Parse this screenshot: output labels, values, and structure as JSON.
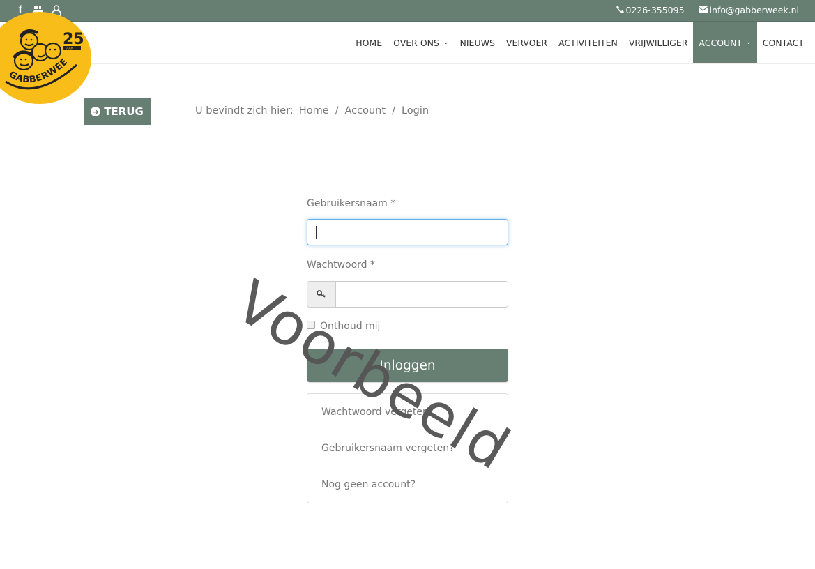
{
  "topbar": {
    "social": [
      {
        "name": "facebook-icon",
        "glyph": "f"
      },
      {
        "name": "youtube-icon",
        "glyph": "▶"
      },
      {
        "name": "user-icon",
        "glyph": "👤"
      }
    ],
    "phone": "0226-355095",
    "email": "info@gabberweek.nl",
    "phone_icon": "✆",
    "email_icon": "✉"
  },
  "logo": {
    "text": "GABBERWEEK",
    "anniversary": "25",
    "anniversary_suffix": "JAAR"
  },
  "nav": {
    "items": [
      {
        "label": "HOME",
        "dropdown": false,
        "active": false
      },
      {
        "label": "OVER ONS",
        "dropdown": true,
        "active": false
      },
      {
        "label": "NIEUWS",
        "dropdown": false,
        "active": false
      },
      {
        "label": "VERVOER",
        "dropdown": false,
        "active": false
      },
      {
        "label": "ACTIVITEITEN",
        "dropdown": false,
        "active": false
      },
      {
        "label": "VRIJWILLIGER",
        "dropdown": false,
        "active": false
      },
      {
        "label": "ACCOUNT",
        "dropdown": true,
        "active": true
      },
      {
        "label": "CONTACT",
        "dropdown": false,
        "active": false
      }
    ],
    "caret": "⌄"
  },
  "back_button": {
    "label": "TERUG",
    "icon": "←"
  },
  "breadcrumb": {
    "prefix": "U bevindt zich hier:",
    "items": [
      "Home",
      "Account",
      "Login"
    ],
    "separator": "/"
  },
  "form": {
    "username_label": "Gebruikersnaam *",
    "username_value": "",
    "password_label": "Wachtwoord *",
    "password_value": "",
    "password_icon": "🔑",
    "remember_label": "Onthoud mij",
    "remember_checked": false,
    "submit_label": "Inloggen"
  },
  "links": [
    "Wachtwoord vergeten?",
    "Gebruikersnaam vergeten?",
    "Nog geen account?"
  ],
  "watermark": "Voorbeeld",
  "colors": {
    "brand": "#677f73",
    "logo_yellow": "#f9bd19"
  }
}
